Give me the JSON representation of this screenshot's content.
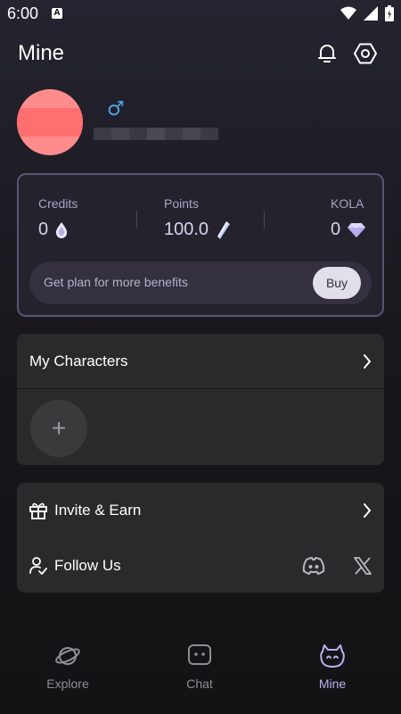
{
  "status_bar": {
    "time": "6:00",
    "a_label": "A"
  },
  "header": {
    "title": "Mine"
  },
  "profile": {
    "gender_symbol": "♂"
  },
  "stats": {
    "credits": {
      "label": "Credits",
      "value": "0"
    },
    "points": {
      "label": "Points",
      "value": "100.0"
    },
    "kola": {
      "label": "KOLA",
      "value": "0"
    }
  },
  "plan": {
    "text": "Get plan for more benefits",
    "buy_label": "Buy"
  },
  "characters": {
    "title": "My Characters",
    "add_symbol": "+"
  },
  "social": {
    "invite_label": "Invite & Earn",
    "follow_label": "Follow Us"
  },
  "nav": {
    "items": [
      {
        "label": "Explore",
        "icon": "planet-icon"
      },
      {
        "label": "Chat",
        "icon": "chat-bubble-icon"
      },
      {
        "label": "Mine",
        "icon": "bot-face-icon"
      }
    ],
    "active": "Mine"
  },
  "colors": {
    "accent": "#b9b2f0",
    "gender": "#4aa3e8",
    "avatar": "#ff8c8c"
  }
}
